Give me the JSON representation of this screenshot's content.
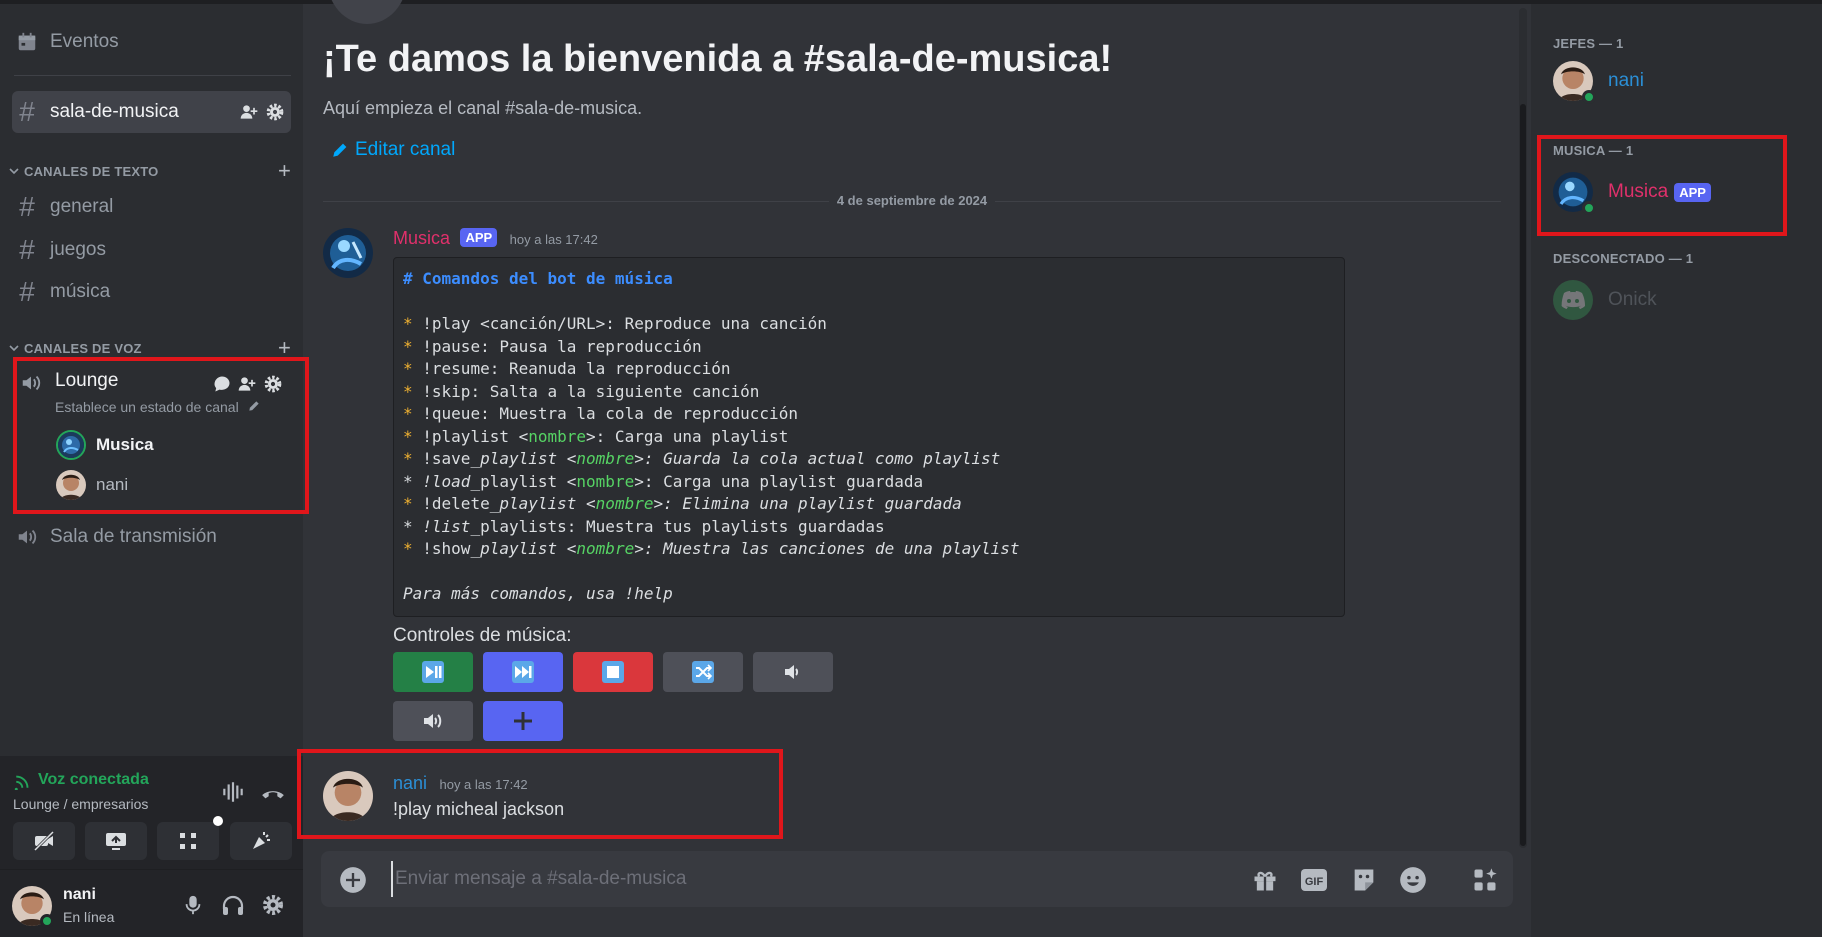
{
  "sidebar": {
    "events_label": "Eventos",
    "current_channel": "sala-de-musica",
    "text_category": "CANALES DE TEXTO",
    "text_channels": [
      "general",
      "juegos",
      "música"
    ],
    "voice_category": "CANALES DE VOZ",
    "lounge": {
      "name": "Lounge",
      "status_hint": "Establece un estado de canal",
      "users": [
        "Musica",
        "nani"
      ]
    },
    "broadcast_channel": "Sala de transmisión"
  },
  "voice_panel": {
    "status": "Voz conectada",
    "location": "Lounge / empresarios"
  },
  "user_panel": {
    "username": "nani",
    "status": "En línea"
  },
  "main": {
    "welcome_title": "¡Te damos la bienvenida a #sala-de-musica!",
    "welcome_subtitle": "Aquí empieza el canal #sala-de-musica.",
    "edit_channel": "Editar canal",
    "date_divider": "4 de septiembre de 2024",
    "bot_message": {
      "username": "Musica",
      "tag": "APP",
      "time": "hoy a las 17:42",
      "code_lines": [
        [
          {
            "t": "# Comandos del bot de música",
            "c": "md-h"
          }
        ],
        [
          {
            "t": " ",
            "c": ""
          }
        ],
        [
          {
            "t": "*",
            "c": "md-b"
          },
          {
            "t": " !play <canción/URL>: Reproduce una canción",
            "c": ""
          }
        ],
        [
          {
            "t": "*",
            "c": "md-b"
          },
          {
            "t": " !pause: Pausa la reproducción",
            "c": ""
          }
        ],
        [
          {
            "t": "*",
            "c": "md-b"
          },
          {
            "t": " !resume: Reanuda la reproducción",
            "c": ""
          }
        ],
        [
          {
            "t": "*",
            "c": "md-b"
          },
          {
            "t": " !skip: Salta a la siguiente canción",
            "c": ""
          }
        ],
        [
          {
            "t": "*",
            "c": "md-b"
          },
          {
            "t": " !queue: Muestra la cola de reproducción",
            "c": ""
          }
        ],
        [
          {
            "t": "*",
            "c": "md-b"
          },
          {
            "t": " !playlist <",
            "c": ""
          },
          {
            "t": "nombre",
            "c": "md-g"
          },
          {
            "t": ">: Carga una playlist",
            "c": ""
          }
        ],
        [
          {
            "t": "*",
            "c": "md-b"
          },
          {
            "t": " !save",
            "c": ""
          },
          {
            "t": "_playlist <",
            "c": "md-i"
          },
          {
            "t": "nombre",
            "c": "md-g md-i"
          },
          {
            "t": ">: Guarda la cola actual como playlist",
            "c": "md-i"
          }
        ],
        [
          {
            "t": "* !load",
            "c": "md-i"
          },
          {
            "t": "_playlist <",
            "c": ""
          },
          {
            "t": "nombre",
            "c": "md-g"
          },
          {
            "t": ">: Carga una playlist guardada",
            "c": ""
          }
        ],
        [
          {
            "t": "*",
            "c": "md-b"
          },
          {
            "t": " !delete",
            "c": ""
          },
          {
            "t": "_playlist <",
            "c": "md-i"
          },
          {
            "t": "nombre",
            "c": "md-g md-i"
          },
          {
            "t": ">: Elimina una playlist guardada",
            "c": "md-i"
          }
        ],
        [
          {
            "t": "* !list",
            "c": "md-i"
          },
          {
            "t": "_playlists: Muestra tus playlists guardadas",
            "c": ""
          }
        ],
        [
          {
            "t": "*",
            "c": "md-b"
          },
          {
            "t": " !show",
            "c": ""
          },
          {
            "t": "_playlist <",
            "c": "md-i"
          },
          {
            "t": "nombre",
            "c": "md-g md-i"
          },
          {
            "t": ">: Muestra las canciones de una playlist",
            "c": "md-i"
          }
        ],
        [
          {
            "t": " ",
            "c": ""
          }
        ],
        [
          {
            "t": "Para más comandos, usa !help",
            "c": "md-i"
          }
        ]
      ],
      "controls_label": "Controles de música:"
    },
    "user_message": {
      "username": "nani",
      "time": "hoy a las 17:42",
      "text": "!play micheal jackson"
    },
    "input_placeholder": "Enviar mensaje a #sala-de-musica"
  },
  "members": {
    "groups": [
      {
        "title": "JEFES — 1",
        "members": [
          {
            "name": "nani"
          }
        ]
      },
      {
        "title": "MUSICA — 1",
        "members": [
          {
            "name": "Musica",
            "tag": "APP"
          }
        ]
      },
      {
        "title": "DESCONECTADO — 1",
        "members": [
          {
            "name": "Onick"
          }
        ]
      }
    ]
  },
  "colors": {
    "bot_name": "#e0306b",
    "user_name": "#2b8fd6",
    "connected_green": "#23a55a",
    "danger_red": "#da373c",
    "blurple": "#5865f2",
    "link_blue": "#00a8fc",
    "highlight_box": "#e0161b"
  },
  "icons": [
    "calendar-icon",
    "hash-icon",
    "add-member-icon",
    "gear-icon",
    "plus-icon",
    "chevron-down-icon",
    "speaker-icon",
    "chat-bubble-icon",
    "pencil-icon",
    "signal-icon",
    "soundboard-icon",
    "hangup-icon",
    "camera-off-icon",
    "screen-share-icon",
    "activities-icon",
    "sparkle-icon",
    "mic-icon",
    "headphones-icon",
    "play-pause-icon",
    "skip-icon",
    "stop-icon",
    "shuffle-icon",
    "volume-down-icon",
    "volume-up-icon",
    "add-icon",
    "gift-icon",
    "gif-icon",
    "sticker-icon",
    "emoji-icon",
    "apps-icon"
  ]
}
